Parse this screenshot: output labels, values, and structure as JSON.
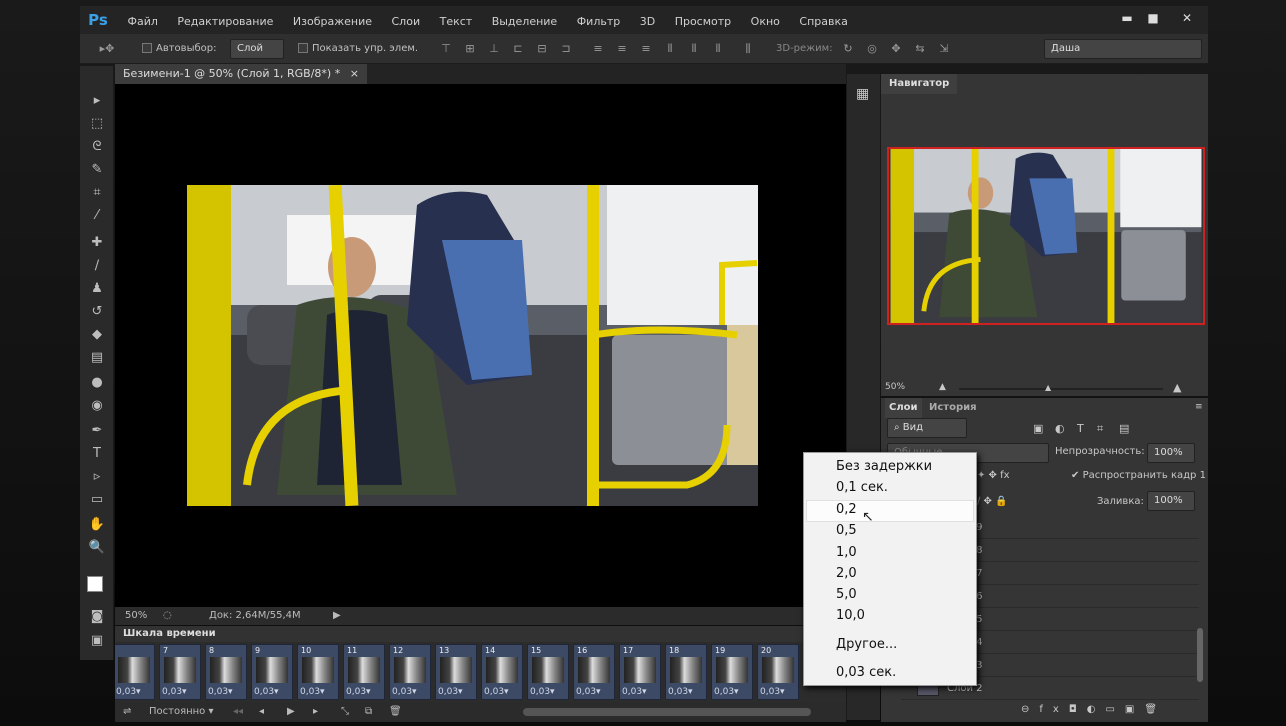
{
  "menubar": {
    "logo": "Ps",
    "items": [
      "Файл",
      "Редактирование",
      "Изображение",
      "Слои",
      "Текст",
      "Выделение",
      "Фильтр",
      "3D",
      "Просмотр",
      "Окно",
      "Справка"
    ],
    "minimize": "▬",
    "maximize": "■",
    "close": "✕"
  },
  "options": {
    "autoselect_label": "Автовыбор:",
    "autoselect_value": "Слой",
    "show_controls_label": "Показать упр. элем.",
    "mode3d_label": "3D-режим:",
    "workspace_value": "Даша"
  },
  "document": {
    "tab_title": "Безимени-1 @ 50% (Слой 1, RGB/8*) *",
    "tab_close": "×",
    "zoom": "50%",
    "doc_info": "Док: 2,64M/55,4M"
  },
  "timeline": {
    "title": "Шкала времени",
    "frames": [
      {
        "num": "",
        "delay": "0,03"
      },
      {
        "num": "7",
        "delay": "0,03"
      },
      {
        "num": "8",
        "delay": "0,03"
      },
      {
        "num": "9",
        "delay": "0,03"
      },
      {
        "num": "10",
        "delay": "0,03"
      },
      {
        "num": "11",
        "delay": "0,03"
      },
      {
        "num": "12",
        "delay": "0,03"
      },
      {
        "num": "13",
        "delay": "0,03"
      },
      {
        "num": "14",
        "delay": "0,03"
      },
      {
        "num": "15",
        "delay": "0,03"
      },
      {
        "num": "16",
        "delay": "0,03"
      },
      {
        "num": "17",
        "delay": "0,03"
      },
      {
        "num": "18",
        "delay": "0,03"
      },
      {
        "num": "19",
        "delay": "0,03"
      },
      {
        "num": "20",
        "delay": "0,03"
      }
    ],
    "loop_value": "Постоянно"
  },
  "navigator": {
    "title": "Навигатор",
    "zoom": "50%"
  },
  "layers": {
    "tab_layers": "Слои",
    "tab_history": "История",
    "filter_value": "Вид",
    "blend_value": "Обычные",
    "opacity_label": "Непрозрачность:",
    "opacity_value": "100%",
    "propagate_label": "Распространить кадр 1",
    "fill_label": "Заливка:",
    "fill_value": "100%",
    "rows": [
      "Слой 9",
      "Слой 8",
      "Слой 7",
      "Слой 6",
      "Слой 5",
      "Слой 4",
      "Слой 3",
      "Слой 2"
    ]
  },
  "delay_menu": {
    "items": [
      "Без задержки",
      "0,1 сек.",
      "0,2",
      "0,5",
      "1,0",
      "2,0",
      "5,0",
      "10,0"
    ],
    "other": "Другое...",
    "current": "0,03 сек."
  }
}
